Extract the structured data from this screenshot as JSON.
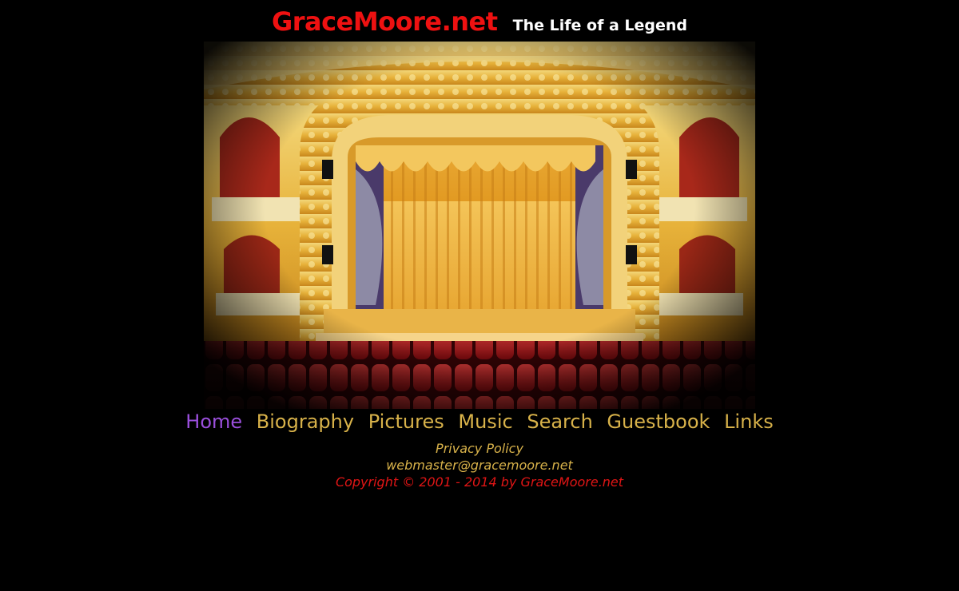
{
  "header": {
    "site_name": "GraceMoore.net",
    "tagline": "The Life of a Legend"
  },
  "hero": {
    "subject": "theater-stage-interior",
    "colors": {
      "gold": "#e8b437",
      "seat_red": "#c8161b",
      "curtain": "#f0b73a"
    }
  },
  "nav": {
    "items": [
      {
        "label": "Home",
        "active": true
      },
      {
        "label": "Biography",
        "active": false
      },
      {
        "label": "Pictures",
        "active": false
      },
      {
        "label": "Music",
        "active": false
      },
      {
        "label": "Search",
        "active": false
      },
      {
        "label": "Guestbook",
        "active": false
      },
      {
        "label": "Links",
        "active": false
      }
    ],
    "colors": {
      "link": "#d8b24a",
      "active": "#9a4fdc"
    }
  },
  "footer": {
    "privacy_label": "Privacy Policy",
    "email": "webmaster@gracemoore.net",
    "copyright": "Copyright © 2001 - 2014 by GraceMoore.net"
  }
}
